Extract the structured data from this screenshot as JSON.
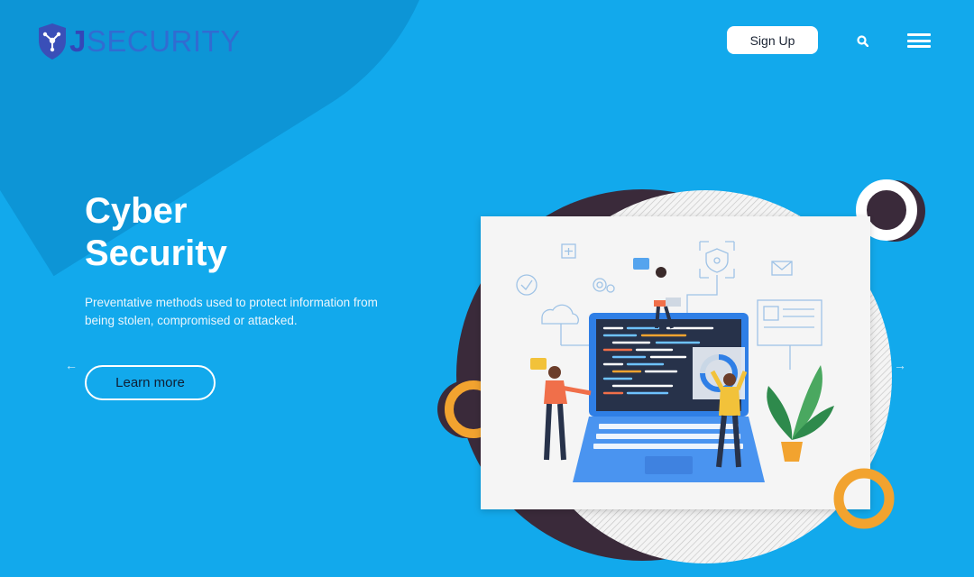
{
  "brand": {
    "logo_letter": "J",
    "logo_rest": "SECURITY"
  },
  "header": {
    "signup_label": "Sign Up",
    "search_icon": "search-icon",
    "menu_icon": "hamburger-menu-icon"
  },
  "hero": {
    "title_line1": "Cyber",
    "title_line2": "Security",
    "description": "Preventative methods used to protect information from being stolen, compromised or attacked.",
    "cta_label": "Learn more"
  },
  "carousel": {
    "prev_icon": "arrow-left-icon",
    "next_icon": "arrow-right-icon",
    "prev_glyph": "←",
    "next_glyph": "→"
  },
  "colors": {
    "background": "#12a9ec",
    "blob": "#0d95d6",
    "accent_orange": "#f2a32f",
    "dark_circle": "#3a2a3a",
    "logo_blue": "#3b5bc9"
  }
}
